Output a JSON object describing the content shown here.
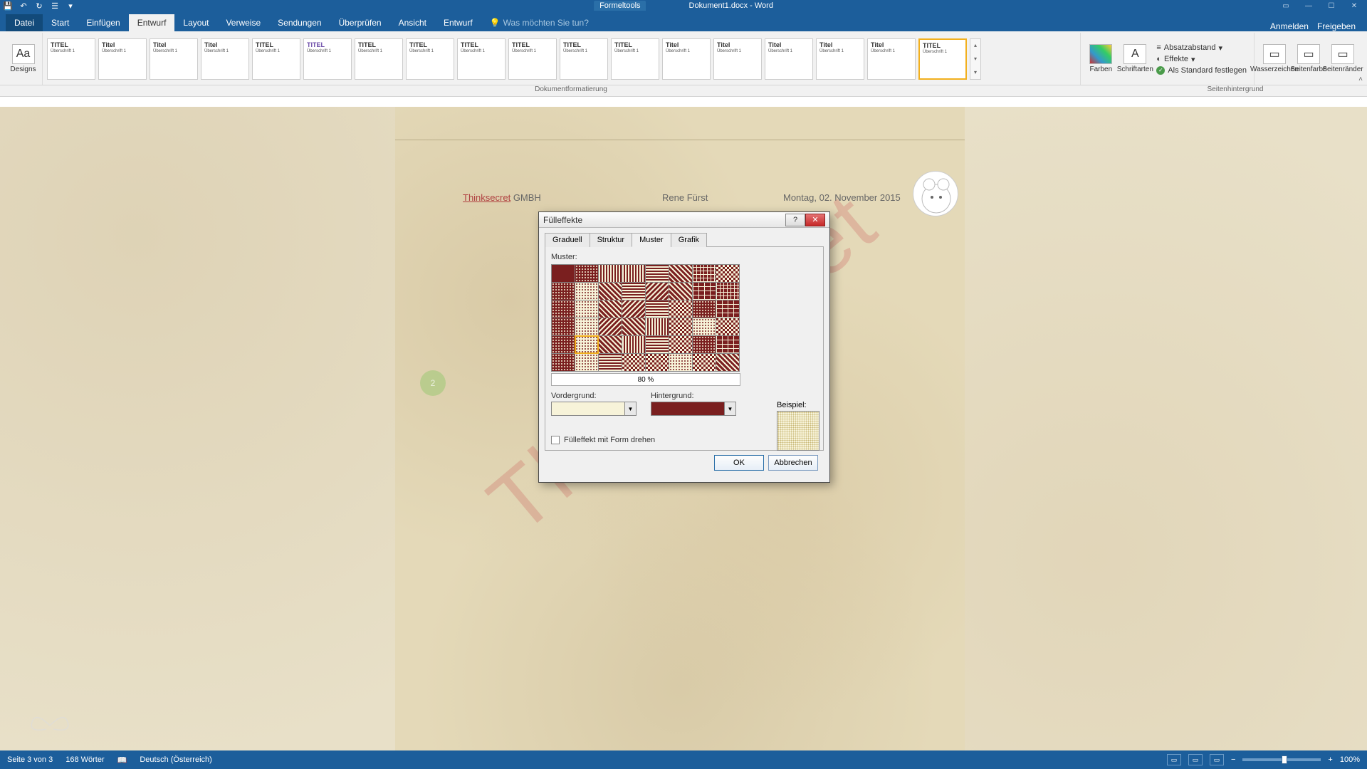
{
  "titlebar": {
    "context_tab": "Formeltools",
    "doc_title": "Dokument1.docx - Word"
  },
  "tabs": {
    "file": "Datei",
    "items": [
      "Start",
      "Einfügen",
      "Entwurf",
      "Layout",
      "Verweise",
      "Sendungen",
      "Überprüfen",
      "Ansicht",
      "Entwurf"
    ],
    "active_index": 2,
    "tell_me": "Was möchten Sie tun?",
    "signin": "Anmelden",
    "share": "Freigeben"
  },
  "ribbon": {
    "designs_label": "Designs",
    "doc_format_label": "Dokumentformatierung",
    "page_bg_label": "Seitenhintergrund",
    "style_titles": [
      "TITEL",
      "Titel",
      "Titel",
      "Titel",
      "TITEL",
      "TITEL",
      "TITEL",
      "TITEL",
      "TITEL",
      "TITEL",
      "TITEL",
      "TITEL",
      "Titel",
      "Titel",
      "Titel",
      "Titel",
      "Titel",
      "TITEL"
    ],
    "style_sub": "Überschrift 1",
    "colors": "Farben",
    "fonts": "Schriftarten",
    "para_spacing": "Absatzabstand",
    "effects": "Effekte",
    "set_default": "Als Standard festlegen",
    "watermark": "Wasserzeichen",
    "page_color": "Seitenfarbe",
    "page_borders": "Seitenränder"
  },
  "doc": {
    "header_company_red": "Thinksecret",
    "header_company_rest": " GMBH",
    "header_name": "Rene Fürst",
    "header_date": "Montag, 02. November 2015",
    "watermark_text": "Thinksecret",
    "green_badge": "2"
  },
  "dialog": {
    "title": "Fülleffekte",
    "tabs": [
      "Graduell",
      "Struktur",
      "Muster",
      "Grafik"
    ],
    "active_tab": 2,
    "pattern_label": "Muster:",
    "pattern_name": "80 %",
    "fg_label": "Vordergrund:",
    "bg_label": "Hintergrund:",
    "fg_color": "#f7f3d9",
    "bg_color": "#7a1f1f",
    "rotate_label": "Fülleffekt mit Form drehen",
    "sample_label": "Beispiel:",
    "ok": "OK",
    "cancel": "Abbrechen"
  },
  "status": {
    "page": "Seite 3 von 3",
    "words": "168 Wörter",
    "lang": "Deutsch (Österreich)",
    "zoom": "100%"
  }
}
